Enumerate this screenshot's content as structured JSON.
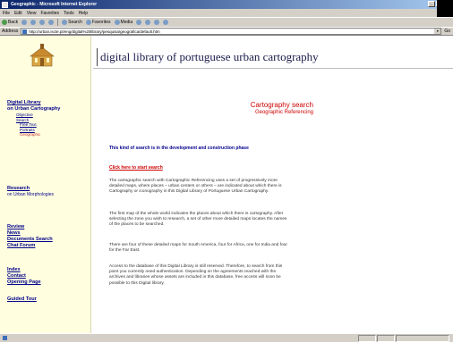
{
  "window": {
    "title": "Geographic - Microsoft Internet Explorer"
  },
  "menu": [
    "File",
    "Edit",
    "View",
    "Favorites",
    "Tools",
    "Help"
  ],
  "toolbar": {
    "back": "Back",
    "search": "Search",
    "favorites": "Favorites",
    "media": "Media"
  },
  "address": {
    "label": "Address",
    "url": "http://urban.iscte.pt/eng/digital%20library/pesquisa/geografica/default.htm",
    "go": "Go"
  },
  "site": {
    "title": "digital library of portuguese urban cartography"
  },
  "sidebar": {
    "digital_library": "Digital Library",
    "digital_library_sub": "on Urban Cartography",
    "items": [
      "Objective",
      "Search"
    ],
    "search_sub": [
      "Free Text",
      "Portraits",
      "Geographic"
    ],
    "research": "Research",
    "research_sub": "on Urban Morphologies",
    "links1": [
      "Review",
      "News",
      "Documents Search",
      "Chat Forum"
    ],
    "links2": [
      "Index",
      "Contact",
      "Opening Page"
    ],
    "guided_tour": "Guided Tour"
  },
  "main": {
    "title": "Cartography search",
    "subtitle": "Geographic Referencing",
    "notice": "This kind of search is in the development and construction phase",
    "start_link": "Click here to start search",
    "paragraphs": [
      "The cartographic search with Cartographic Referencing uses a set of progressively more detailed maps, where places – urban centers or others – are indicated about which there is Cartography or iconography in this Digital Library of Portuguese Urban Cartography.",
      "The first map of the whole world indicates the places about which there is cartography. After selecting the zone you wish to research, a set of other more detailed maps locates the names of the places to be searched.",
      "There are four of these detailed maps for South America, four for Africa, one for India and four for the Far East.",
      "Access to the database of this Digital Library is still reserved. Therefore, to search from this point you currently need authentication. Depending on the agreements reached with the archives and libraries whose assets are included in this database, free access will soon be possible to this Digital library."
    ]
  },
  "colors": {
    "sidebar_bg": "#ffffe0",
    "link": "#00008b",
    "accent": "#cc0000"
  }
}
